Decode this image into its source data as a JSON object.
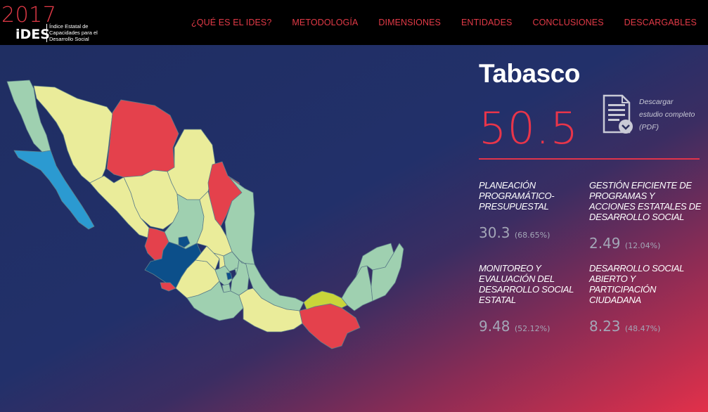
{
  "header": {
    "logo": {
      "year": "2017",
      "acronym": "iDES",
      "subtitle": "Índice Estatal de Capacidades para el Desarrollo Social"
    },
    "nav": [
      {
        "label": "¿QUÉ ES EL IDES?"
      },
      {
        "label": "METODOLOGÍA"
      },
      {
        "label": "DIMENSIONES"
      },
      {
        "label": "ENTIDADES"
      },
      {
        "label": "CONCLUSIONES"
      },
      {
        "label": "DESCARGABLES"
      }
    ]
  },
  "colors": {
    "accent_red": "#e23a47",
    "map_red": "#e4414c",
    "map_blue": "#0c4f8a",
    "map_light_blue": "#2b9ad1",
    "map_green": "#9fd0b0",
    "map_yellow": "#eaec9a",
    "map_lime": "#c9d43a"
  },
  "state": {
    "name": "Tabasco",
    "score": "50.5",
    "download": {
      "icon": "pdf-download-icon",
      "label": "Descargar estudio completo (PDF)"
    }
  },
  "dimensions": [
    {
      "title": "PLANEACIÓN PROGRAMÁTICO-PRESUPUESTAL",
      "value": "30.3",
      "percent": "(68.65%)"
    },
    {
      "title": "GESTIÓN EFICIENTE DE PROGRAMAS Y ACCIONES ESTATALES DE DESARROLLO SOCIAL",
      "value": "2.49",
      "percent": "(12.04%)"
    },
    {
      "title": "MONITOREO Y EVALUACIÓN DEL DESARROLLO SOCIAL ESTATAL",
      "value": "9.48",
      "percent": "(52.12%)"
    },
    {
      "title": "DESARROLLO SOCIAL ABIERTO Y PARTICIPACIÓN CIUDADANA",
      "value": "8.23",
      "percent": "(48.47%)"
    }
  ]
}
